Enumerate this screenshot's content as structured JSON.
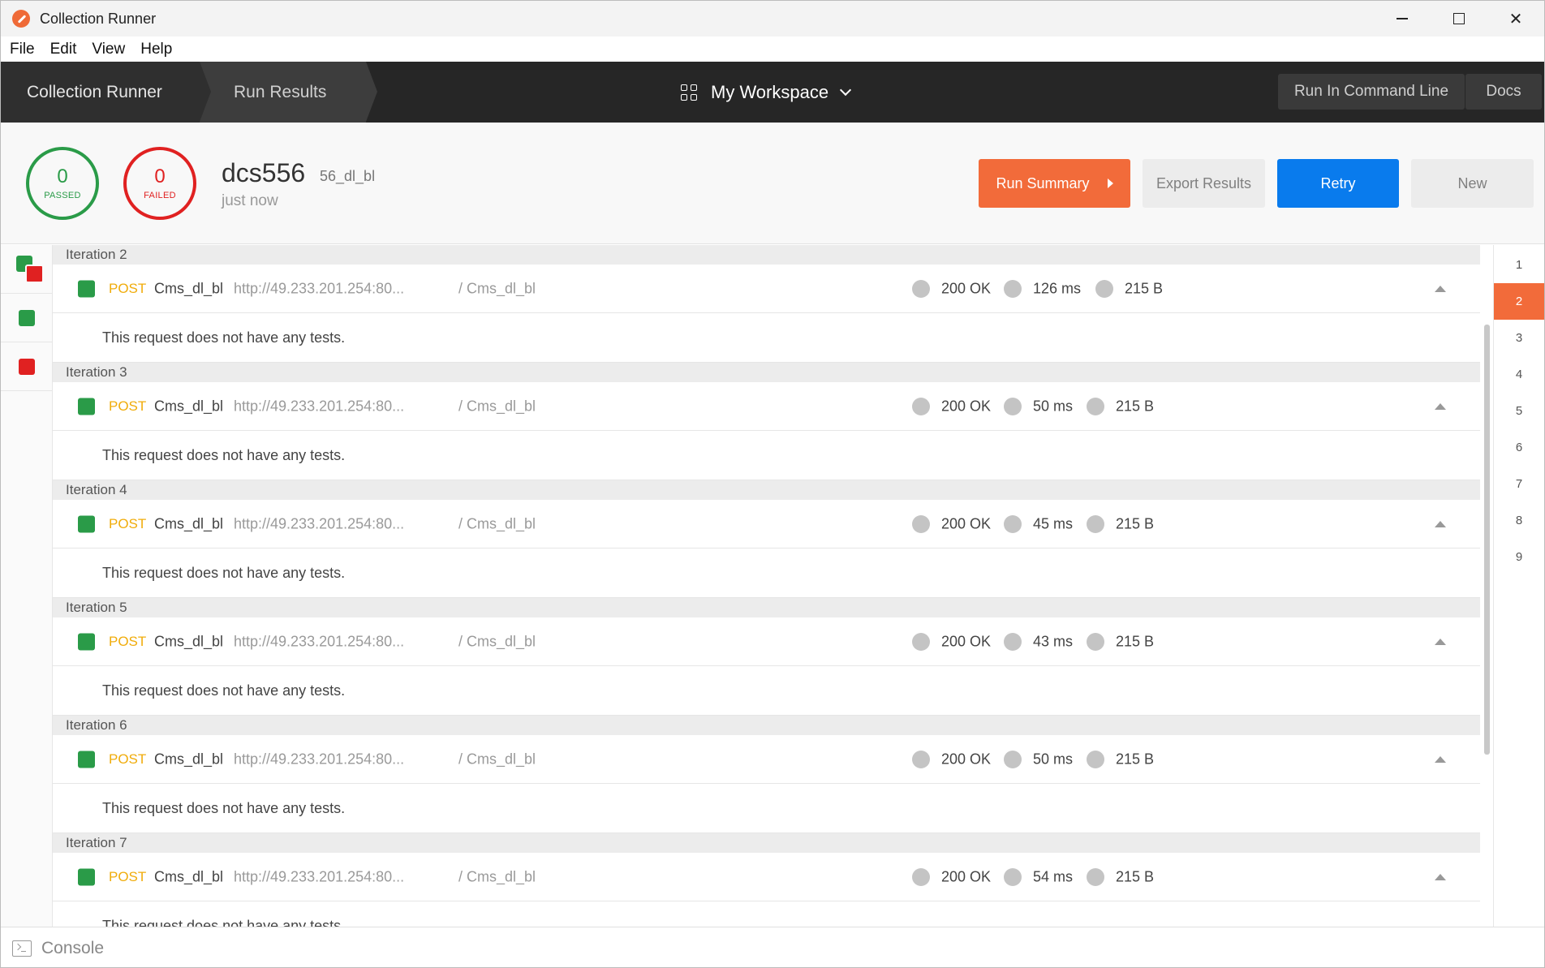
{
  "window": {
    "title": "Collection Runner"
  },
  "menu": [
    "File",
    "Edit",
    "View",
    "Help"
  ],
  "header": {
    "breadcrumb": [
      "Collection Runner",
      "Run Results"
    ],
    "workspace": "My Workspace",
    "run_cli": "Run In Command Line",
    "docs": "Docs"
  },
  "summary": {
    "passed": {
      "count": "0",
      "label": "PASSED"
    },
    "failed": {
      "count": "0",
      "label": "FAILED"
    },
    "collection": "dcs556",
    "environment": "56_dl_bl",
    "time": "just now",
    "buttons": {
      "run_summary": "Run Summary",
      "export": "Export Results",
      "retry": "Retry",
      "new": "New"
    }
  },
  "colors": {
    "accent": "#f26b3a",
    "pass": "#2a9b48",
    "fail": "#e02121",
    "primary": "#097bed",
    "method_post": "#f0ac0b"
  },
  "iterations": [
    {
      "label": "Iteration 2",
      "method": "POST",
      "name": "Cms_dl_bl",
      "url": "http://49.233.201.254:80...",
      "path": "/ Cms_dl_bl",
      "status": "200 OK",
      "time": "126 ms",
      "size": "215 B",
      "note": "This request does not have any tests."
    },
    {
      "label": "Iteration 3",
      "method": "POST",
      "name": "Cms_dl_bl",
      "url": "http://49.233.201.254:80...",
      "path": "/ Cms_dl_bl",
      "status": "200 OK",
      "time": "50 ms",
      "size": "215 B",
      "note": "This request does not have any tests."
    },
    {
      "label": "Iteration 4",
      "method": "POST",
      "name": "Cms_dl_bl",
      "url": "http://49.233.201.254:80...",
      "path": "/ Cms_dl_bl",
      "status": "200 OK",
      "time": "45 ms",
      "size": "215 B",
      "note": "This request does not have any tests."
    },
    {
      "label": "Iteration 5",
      "method": "POST",
      "name": "Cms_dl_bl",
      "url": "http://49.233.201.254:80...",
      "path": "/ Cms_dl_bl",
      "status": "200 OK",
      "time": "43 ms",
      "size": "215 B",
      "note": "This request does not have any tests."
    },
    {
      "label": "Iteration 6",
      "method": "POST",
      "name": "Cms_dl_bl",
      "url": "http://49.233.201.254:80...",
      "path": "/ Cms_dl_bl",
      "status": "200 OK",
      "time": "50 ms",
      "size": "215 B",
      "note": "This request does not have any tests."
    },
    {
      "label": "Iteration 7",
      "method": "POST",
      "name": "Cms_dl_bl",
      "url": "http://49.233.201.254:80...",
      "path": "/ Cms_dl_bl",
      "status": "200 OK",
      "time": "54 ms",
      "size": "215 B",
      "note": "This request does not have any tests."
    }
  ],
  "iteration_nav": {
    "items": [
      "1",
      "2",
      "3",
      "4",
      "5",
      "6",
      "7",
      "8",
      "9"
    ],
    "active": "2"
  },
  "console": {
    "label": "Console"
  },
  "icons": [
    "app-logo-icon",
    "minimize-icon",
    "maximize-icon",
    "close-icon",
    "grid-icon",
    "chevron-down-icon",
    "play-triangle-icon",
    "collapse-icon",
    "console-icon"
  ]
}
